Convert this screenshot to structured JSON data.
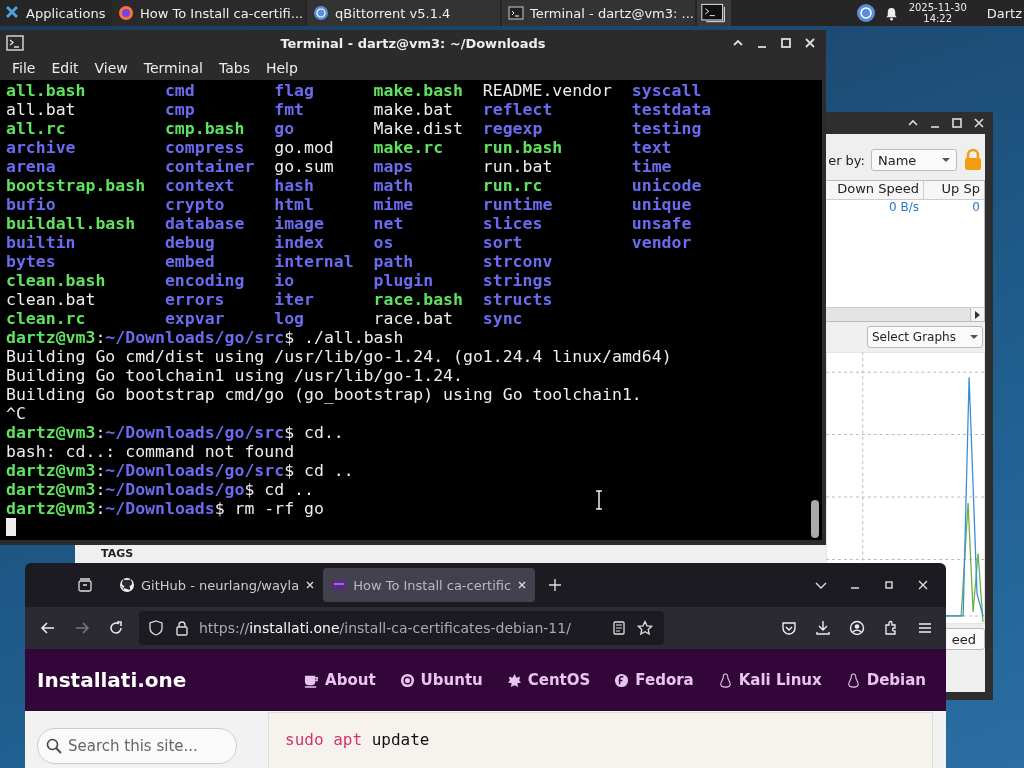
{
  "taskbar": {
    "menu_label": "Applications",
    "tasks": [
      {
        "label": "How To Install ca-certifi...",
        "kind": "browser"
      },
      {
        "label": "qBittorrent v5.1.4",
        "kind": "torrent"
      },
      {
        "label": "Terminal - dartz@vm3: ...",
        "kind": "terminal"
      }
    ],
    "clock": {
      "date": "2025-11-30",
      "time": "14:22"
    },
    "user": "Dartz"
  },
  "qbittorrent": {
    "filter_label": "er by:",
    "filter_value": "Name",
    "columns": [
      "Down Speed",
      "Up Sp"
    ],
    "row": [
      "0 B/s",
      "0"
    ],
    "graph_select": "Select Graphs",
    "bottom_button": "eed",
    "sidebar_heading": "TAGS"
  },
  "terminal": {
    "title": "Terminal - dartz@vm3: ~/Downloads",
    "menu": [
      "File",
      "Edit",
      "View",
      "Terminal",
      "Tabs",
      "Help"
    ],
    "listing": [
      [
        {
          "name": "all.bash",
          "kind": "exec"
        },
        {
          "name": "all.bat",
          "kind": "file"
        },
        {
          "name": "all.rc",
          "kind": "exec"
        },
        {
          "name": "archive",
          "kind": "dir"
        },
        {
          "name": "arena",
          "kind": "dir"
        },
        {
          "name": "bootstrap.bash",
          "kind": "exec"
        },
        {
          "name": "bufio",
          "kind": "dir"
        },
        {
          "name": "buildall.bash",
          "kind": "exec"
        },
        {
          "name": "builtin",
          "kind": "dir"
        },
        {
          "name": "bytes",
          "kind": "dir"
        },
        {
          "name": "clean.bash",
          "kind": "exec"
        },
        {
          "name": "clean.bat",
          "kind": "file"
        },
        {
          "name": "clean.rc",
          "kind": "exec"
        }
      ],
      [
        {
          "name": "cmd",
          "kind": "dir"
        },
        {
          "name": "cmp",
          "kind": "dir"
        },
        {
          "name": "cmp.bash",
          "kind": "exec"
        },
        {
          "name": "compress",
          "kind": "dir"
        },
        {
          "name": "container",
          "kind": "dir"
        },
        {
          "name": "context",
          "kind": "dir"
        },
        {
          "name": "crypto",
          "kind": "dir"
        },
        {
          "name": "database",
          "kind": "dir"
        },
        {
          "name": "debug",
          "kind": "dir"
        },
        {
          "name": "embed",
          "kind": "dir"
        },
        {
          "name": "encoding",
          "kind": "dir"
        },
        {
          "name": "errors",
          "kind": "dir"
        },
        {
          "name": "expvar",
          "kind": "dir"
        }
      ],
      [
        {
          "name": "flag",
          "kind": "dir"
        },
        {
          "name": "fmt",
          "kind": "dir"
        },
        {
          "name": "go",
          "kind": "dir"
        },
        {
          "name": "go.mod",
          "kind": "file"
        },
        {
          "name": "go.sum",
          "kind": "file"
        },
        {
          "name": "hash",
          "kind": "dir"
        },
        {
          "name": "html",
          "kind": "dir"
        },
        {
          "name": "image",
          "kind": "dir"
        },
        {
          "name": "index",
          "kind": "dir"
        },
        {
          "name": "internal",
          "kind": "dir"
        },
        {
          "name": "io",
          "kind": "dir"
        },
        {
          "name": "iter",
          "kind": "dir"
        },
        {
          "name": "log",
          "kind": "dir"
        }
      ],
      [
        {
          "name": "make.bash",
          "kind": "exec"
        },
        {
          "name": "make.bat",
          "kind": "file"
        },
        {
          "name": "Make.dist",
          "kind": "file"
        },
        {
          "name": "make.rc",
          "kind": "exec"
        },
        {
          "name": "maps",
          "kind": "dir"
        },
        {
          "name": "math",
          "kind": "dir"
        },
        {
          "name": "mime",
          "kind": "dir"
        },
        {
          "name": "net",
          "kind": "dir"
        },
        {
          "name": "os",
          "kind": "dir"
        },
        {
          "name": "path",
          "kind": "dir"
        },
        {
          "name": "plugin",
          "kind": "dir"
        },
        {
          "name": "race.bash",
          "kind": "exec"
        },
        {
          "name": "race.bat",
          "kind": "file"
        }
      ],
      [
        {
          "name": "README.vendor",
          "kind": "file"
        },
        {
          "name": "reflect",
          "kind": "dir"
        },
        {
          "name": "regexp",
          "kind": "dir"
        },
        {
          "name": "run.bash",
          "kind": "exec"
        },
        {
          "name": "run.bat",
          "kind": "file"
        },
        {
          "name": "run.rc",
          "kind": "exec"
        },
        {
          "name": "runtime",
          "kind": "dir"
        },
        {
          "name": "slices",
          "kind": "dir"
        },
        {
          "name": "sort",
          "kind": "dir"
        },
        {
          "name": "strconv",
          "kind": "dir"
        },
        {
          "name": "strings",
          "kind": "dir"
        },
        {
          "name": "structs",
          "kind": "dir"
        },
        {
          "name": "sync",
          "kind": "dir"
        }
      ],
      [
        {
          "name": "syscall",
          "kind": "dir"
        },
        {
          "name": "testdata",
          "kind": "dir"
        },
        {
          "name": "testing",
          "kind": "dir"
        },
        {
          "name": "text",
          "kind": "dir"
        },
        {
          "name": "time",
          "kind": "dir"
        },
        {
          "name": "unicode",
          "kind": "dir"
        },
        {
          "name": "unique",
          "kind": "dir"
        },
        {
          "name": "unsafe",
          "kind": "dir"
        },
        {
          "name": "vendor",
          "kind": "dir"
        }
      ]
    ],
    "lines": [
      [
        {
          "text": "dartz@vm3",
          "kind": "user"
        },
        {
          "text": ":",
          "kind": "plain"
        },
        {
          "text": "~/Downloads/go/src",
          "kind": "path"
        },
        {
          "text": "$ ./all.bash",
          "kind": "plain"
        }
      ],
      [
        {
          "text": "Building Go cmd/dist using /usr/lib/go-1.24. (go1.24.4 linux/amd64)",
          "kind": "plain"
        }
      ],
      [
        {
          "text": "Building Go toolchain1 using /usr/lib/go-1.24.",
          "kind": "plain"
        }
      ],
      [
        {
          "text": "Building Go bootstrap cmd/go (go_bootstrap) using Go toolchain1.",
          "kind": "plain"
        }
      ],
      [
        {
          "text": "^C",
          "kind": "plain"
        }
      ],
      [
        {
          "text": "dartz@vm3",
          "kind": "user"
        },
        {
          "text": ":",
          "kind": "plain"
        },
        {
          "text": "~/Downloads/go/src",
          "kind": "path"
        },
        {
          "text": "$ cd..",
          "kind": "plain"
        }
      ],
      [
        {
          "text": "bash: cd..: command not found",
          "kind": "plain"
        }
      ],
      [
        {
          "text": "dartz@vm3",
          "kind": "user"
        },
        {
          "text": ":",
          "kind": "plain"
        },
        {
          "text": "~/Downloads/go/src",
          "kind": "path"
        },
        {
          "text": "$ cd ..",
          "kind": "plain"
        }
      ],
      [
        {
          "text": "dartz@vm3",
          "kind": "user"
        },
        {
          "text": ":",
          "kind": "plain"
        },
        {
          "text": "~/Downloads/go",
          "kind": "path"
        },
        {
          "text": "$ cd ..",
          "kind": "plain"
        }
      ],
      [
        {
          "text": "dartz@vm3",
          "kind": "user"
        },
        {
          "text": ":",
          "kind": "plain"
        },
        {
          "text": "~/Downloads",
          "kind": "path"
        },
        {
          "text": "$ rm -rf go",
          "kind": "plain"
        }
      ]
    ]
  },
  "browser": {
    "tabs": [
      {
        "label": "GitHub - neurlang/wayla",
        "selected": false
      },
      {
        "label": "How To Install ca-certific",
        "selected": true
      }
    ],
    "url_scheme": "https://",
    "url_host": "installati.one",
    "url_path": "/install-ca-certificates-debian-11/",
    "site_name": "Installati.one",
    "nav": [
      {
        "label": "About",
        "kind": "cup"
      },
      {
        "label": "Ubuntu",
        "kind": "ubuntu"
      },
      {
        "label": "CentOS",
        "kind": "centos"
      },
      {
        "label": "Fedora",
        "kind": "fedora"
      },
      {
        "label": "Kali Linux",
        "kind": "linux"
      },
      {
        "label": "Debian",
        "kind": "linux"
      }
    ],
    "search": {
      "placeholder": "Search this site..."
    },
    "code": [
      {
        "text": "sudo",
        "kind": "keyword"
      },
      {
        "text": " apt",
        "kind": "keyword"
      },
      {
        "text": " update",
        "kind": "plain"
      }
    ]
  }
}
